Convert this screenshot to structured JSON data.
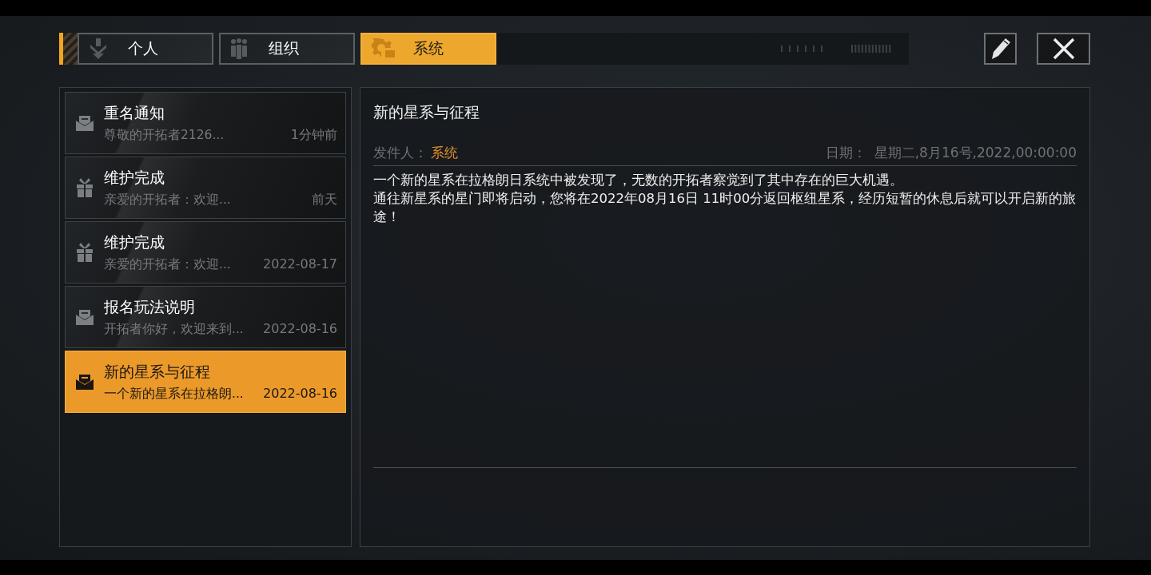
{
  "tabs": [
    {
      "label": "个人",
      "selected": false
    },
    {
      "label": "组织",
      "selected": false
    },
    {
      "label": "系统",
      "selected": true
    }
  ],
  "mail_list": [
    {
      "kind": "mail",
      "title": "重名通知",
      "preview": "尊敬的开拓者2126...",
      "time": "1分钟前",
      "selected": false
    },
    {
      "kind": "gift",
      "title": "维护完成",
      "preview": "亲爱的开拓者：欢迎...",
      "time": "前天",
      "selected": false
    },
    {
      "kind": "gift",
      "title": "维护完成",
      "preview": "亲爱的开拓者：欢迎...",
      "time": "2022-08-17",
      "selected": false
    },
    {
      "kind": "mail",
      "title": "报名玩法说明",
      "preview": "开拓者你好，欢迎来到...",
      "time": "2022-08-16",
      "selected": false
    },
    {
      "kind": "mail",
      "title": "新的星系与征程",
      "preview": "一个新的星系在拉格朗...",
      "time": "2022-08-16",
      "selected": true
    }
  ],
  "detail": {
    "title": "新的星系与征程",
    "sender_label": "发件人：",
    "sender": "系统",
    "date_label": "日期：",
    "date": "星期二,8月16号,2022,00:00:00",
    "body": [
      "一个新的星系在拉格朗日系统中被发现了，无数的开拓者察觉到了其中存在的巨大机遇。",
      "通往新星系的星门即将启动，您将在2022年08月16日 11时00分返回枢纽星系，经历短暂的休息后就可以开启新的旅途！"
    ]
  }
}
